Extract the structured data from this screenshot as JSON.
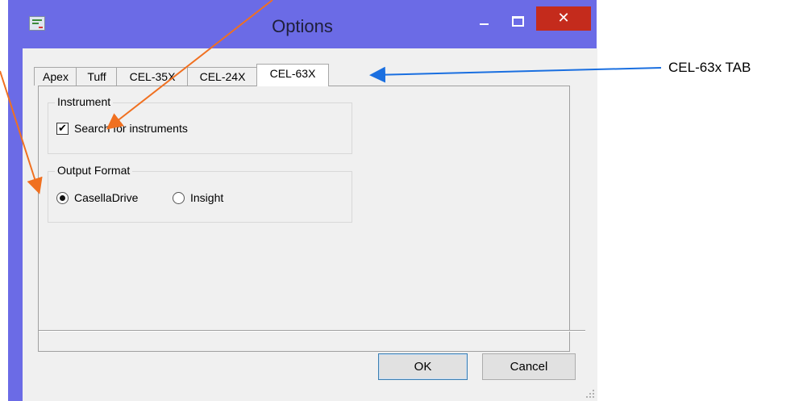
{
  "window": {
    "title": "Options",
    "minimize_icon": "minimize-icon",
    "maximize_icon": "maximize-icon",
    "close_label": "✕"
  },
  "tabs": [
    {
      "label": "Apex",
      "active": false
    },
    {
      "label": "Tuff",
      "active": false
    },
    {
      "label": "CEL-35X",
      "active": false
    },
    {
      "label": "CEL-24X",
      "active": false
    },
    {
      "label": "CEL-63X",
      "active": true
    }
  ],
  "instrument": {
    "group_label": "Instrument",
    "checkbox_label": "Search for instruments",
    "checked": true
  },
  "output_format": {
    "group_label": "Output Format",
    "options": [
      {
        "label": "CasellaDrive",
        "selected": true
      },
      {
        "label": "Insight",
        "selected": false
      }
    ]
  },
  "buttons": {
    "ok": "OK",
    "cancel": "Cancel"
  },
  "annotation": {
    "text": "CEL-63x TAB",
    "arrow_color": "#1a6fe0",
    "orange_arrow_color": "#f07020"
  }
}
